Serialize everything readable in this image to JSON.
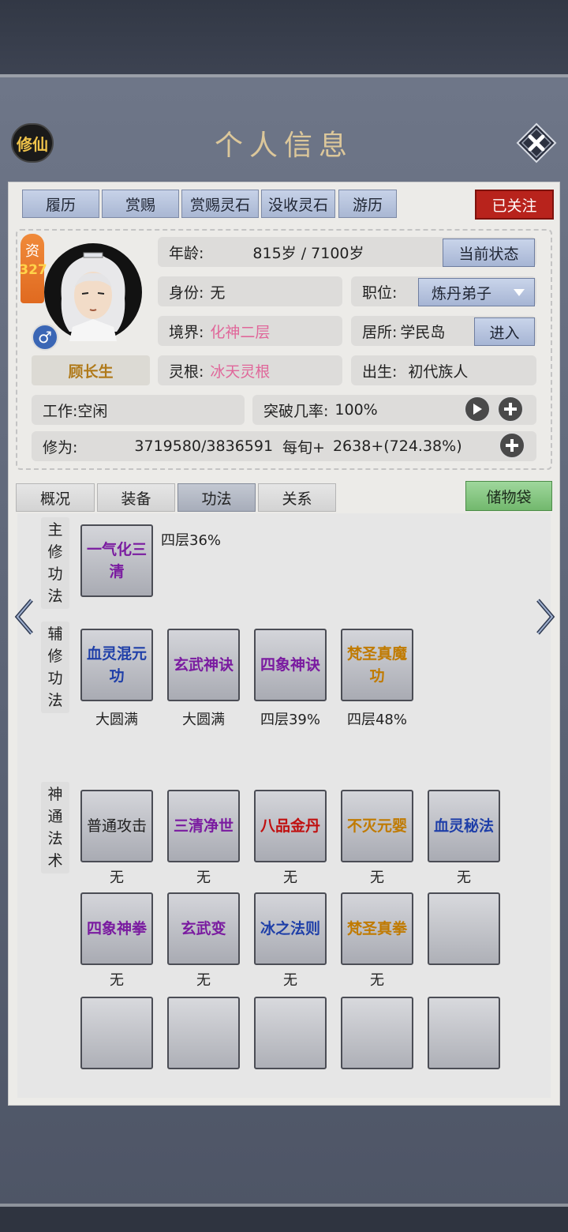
{
  "header": {
    "badge": "修仙",
    "title": "个人信息"
  },
  "tabs": [
    "履历",
    "赏赐",
    "赏赐灵石",
    "没收灵石",
    "游历"
  ],
  "follow_label": "已关注",
  "profile": {
    "aptitude_label": "资",
    "aptitude_value": "327",
    "name": "顾长生",
    "gender_symbol": "♂",
    "age_label": "年龄:",
    "age_value": "815岁 / 7100岁",
    "status_button": "当前状态",
    "identity_label": "身份:",
    "identity_value": "无",
    "position_label": "职位:",
    "position_value": "炼丹弟子",
    "realm_label": "境界:",
    "realm_value": "化神二层",
    "residence_label": "居所:",
    "residence_value": "学民岛",
    "enter_button": "进入",
    "root_label": "灵根:",
    "root_value": "冰天灵根",
    "birth_label": "出生:",
    "birth_value": "初代族人",
    "work_label": "工作:",
    "work_value": "空闲",
    "breakthrough_label": "突破几率:",
    "breakthrough_value": "100%",
    "cultivation_label": "修为:",
    "cultivation_value": "3719580/3836591",
    "per_round_label": "每旬+",
    "per_round_value": "2638+(724.38%)"
  },
  "subtabs": [
    "概况",
    "装备",
    "功法",
    "关系"
  ],
  "storage_bag": "储物袋",
  "sections": {
    "main": {
      "label": [
        "主",
        "修",
        "功",
        "法"
      ]
    },
    "aux": {
      "label": [
        "辅",
        "修",
        "功",
        "法"
      ]
    },
    "magic": {
      "label": [
        "神",
        "通",
        "法",
        "术"
      ]
    }
  },
  "main_skill": {
    "name": "一气化三清",
    "level": "四层36%"
  },
  "aux_skills": [
    {
      "name": "血灵混元功",
      "level": "大圆满"
    },
    {
      "name": "玄武神诀",
      "level": "大圆满"
    },
    {
      "name": "四象神诀",
      "level": "四层39%"
    },
    {
      "name": "梵圣真魔功",
      "level": "四层48%"
    }
  ],
  "magic_row1": [
    {
      "name": "普通攻击",
      "level": "无"
    },
    {
      "name": "三清净世",
      "level": "无"
    },
    {
      "name": "八品金丹",
      "level": "无"
    },
    {
      "name": "不灭元婴",
      "level": "无"
    },
    {
      "name": "血灵秘法",
      "level": "无"
    }
  ],
  "magic_row2": [
    {
      "name": "四象神拳",
      "level": "无"
    },
    {
      "name": "玄武变",
      "level": "无"
    },
    {
      "name": "冰之法则",
      "level": "无"
    },
    {
      "name": "梵圣真拳",
      "level": "无"
    }
  ]
}
